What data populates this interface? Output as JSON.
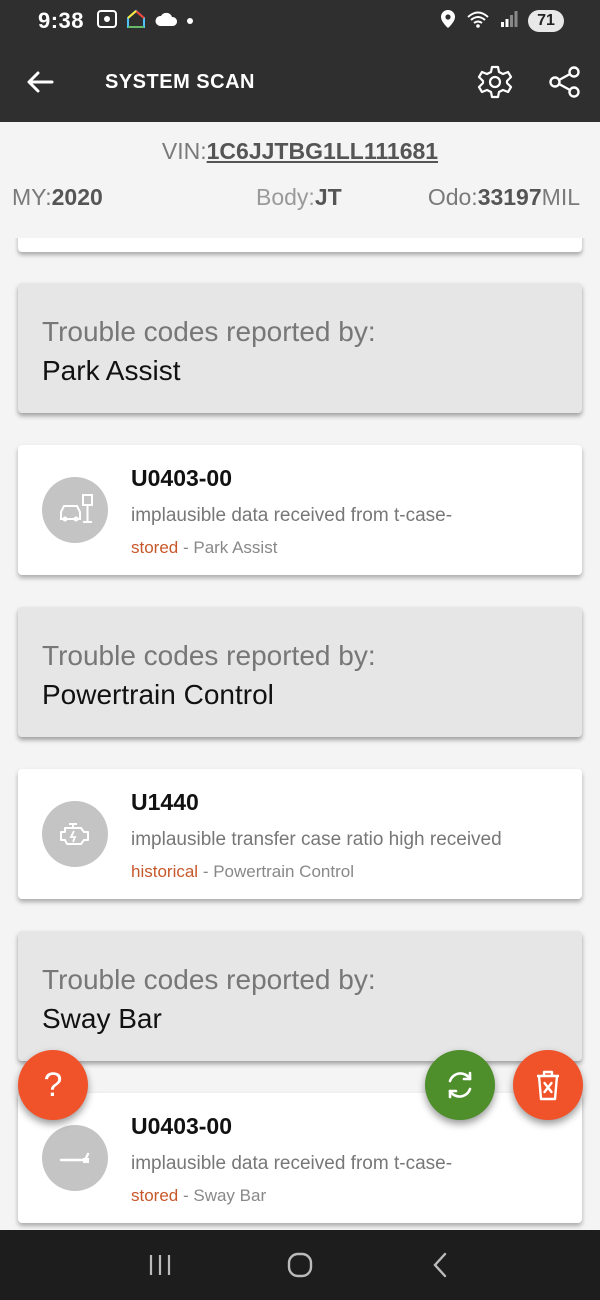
{
  "status_bar": {
    "time": "9:38",
    "battery": "71",
    "wifi_label": "5"
  },
  "app_bar": {
    "title": "SYSTEM SCAN"
  },
  "vehicle": {
    "vin_label": "VIN:",
    "vin": "1C6JJTBG1LL111681",
    "my_label": "MY:",
    "my": "2020",
    "body_label": "Body:",
    "body": "JT",
    "odo_label": "Odo:",
    "odo": "33197",
    "odo_unit": "MIL"
  },
  "groups": [
    {
      "caption": "Trouble codes reported by:",
      "module": "Park Assist",
      "code": {
        "id": "U0403-00",
        "description": "implausible data received from t-case-",
        "status": "stored",
        "source": " - Park Assist",
        "icon": "park-assist-icon"
      }
    },
    {
      "caption": "Trouble codes reported by:",
      "module": "Powertrain Control",
      "code": {
        "id": "U1440",
        "description": "implausible transfer case ratio high received",
        "status": "historical",
        "source": " - Powertrain Control",
        "icon": "engine-icon"
      }
    },
    {
      "caption": "Trouble codes reported by:",
      "module": "Sway Bar",
      "code": {
        "id": "U0403-00",
        "description": "implausible data received from t-case-",
        "status": "stored",
        "source": " - Sway Bar",
        "icon": "sway-bar-icon"
      }
    }
  ],
  "fabs": {
    "help": "?"
  },
  "colors": {
    "bar": "#2f2f2f",
    "status": "#c7582b",
    "fab_orange": "#f0522a",
    "fab_green": "#4e8e2b",
    "group_bg": "#e6e6e6"
  }
}
